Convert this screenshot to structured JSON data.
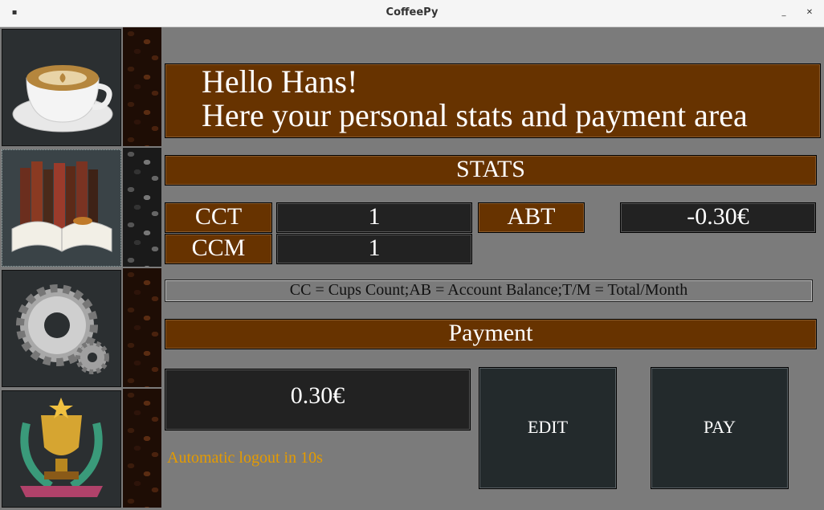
{
  "window": {
    "title": "CoffeePy",
    "menu_glyph": "▪",
    "minimize_glyph": "_",
    "close_glyph": "✕"
  },
  "sidebar": {
    "items": [
      {
        "name": "coffee-cup",
        "icon": "coffee-cup-icon"
      },
      {
        "name": "books",
        "icon": "books-icon"
      },
      {
        "name": "settings",
        "icon": "gear-icon"
      },
      {
        "name": "trophy",
        "icon": "trophy-icon"
      }
    ]
  },
  "greeting": {
    "line1": "Hello Hans!",
    "line2": "Here your personal stats and payment area"
  },
  "stats": {
    "header": "STATS",
    "cct_label": "CCT",
    "cct_value": "1",
    "ccm_label": "CCM",
    "ccm_value": "1",
    "abt_label": "ABT",
    "abt_value": "-0.30€",
    "legend": "CC = Cups Count;AB = Account Balance;T/M = Total/Month"
  },
  "payment": {
    "header": "Payment",
    "amount": "0.30€",
    "edit_label": "EDIT",
    "pay_label": "PAY"
  },
  "status": {
    "logout_text": "Automatic logout in 10s"
  },
  "colors": {
    "background": "#7b7b7b",
    "brown_panel": "#673300",
    "dark_panel": "#222222",
    "logout_text": "#e59b00"
  }
}
